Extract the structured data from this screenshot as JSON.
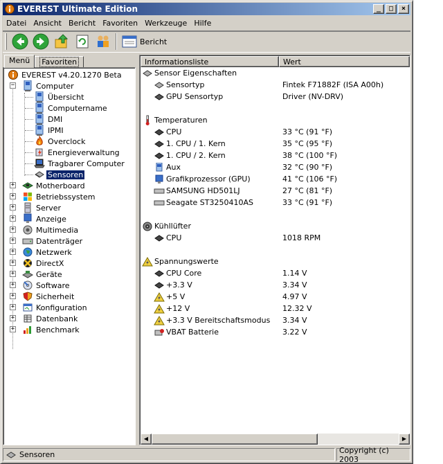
{
  "window": {
    "title": "EVEREST Ultimate Edition",
    "icon": "info-icon"
  },
  "title_buttons": {
    "minimize": "_",
    "maximize": "□",
    "close": "×"
  },
  "menu": [
    "Datei",
    "Ansicht",
    "Bericht",
    "Favoriten",
    "Werkzeuge",
    "Hilfe"
  ],
  "toolbar": {
    "report_label": "Bericht"
  },
  "tabs": {
    "menu": "Menü",
    "favorites": "Favoriten"
  },
  "tree": {
    "root": "EVEREST v4.20.1270 Beta",
    "computer": "Computer",
    "computer_children": [
      "Übersicht",
      "Computername",
      "DMI",
      "IPMI",
      "Overclock",
      "Energieverwaltung",
      "Tragbarer Computer",
      "Sensoren"
    ],
    "sections": [
      "Motherboard",
      "Betriebssystem",
      "Server",
      "Anzeige",
      "Multimedia",
      "Datenträger",
      "Netzwerk",
      "DirectX",
      "Geräte",
      "Software",
      "Sicherheit",
      "Konfiguration",
      "Datenbank",
      "Benchmark"
    ]
  },
  "columns": {
    "field": "Informationsliste",
    "value": "Wert"
  },
  "groups": {
    "sensor_props": "Sensor Eigenschaften",
    "temps": "Temperaturen",
    "fans": "Kühllüfter",
    "voltages": "Spannungswerte"
  },
  "sensor_props": [
    {
      "field": "Sensortyp",
      "value": "Fintek F71882F  (ISA A00h)"
    },
    {
      "field": "GPU Sensortyp",
      "value": "Driver  (NV-DRV)"
    }
  ],
  "temps": [
    {
      "field": "CPU",
      "value": "33 °C  (91 °F)"
    },
    {
      "field": "1. CPU / 1. Kern",
      "value": "35 °C  (95 °F)"
    },
    {
      "field": "1. CPU / 2. Kern",
      "value": "38 °C  (100 °F)"
    },
    {
      "field": "Aux",
      "value": "32 °C  (90 °F)"
    },
    {
      "field": "Grafikprozessor (GPU)",
      "value": "41 °C  (106 °F)"
    },
    {
      "field": "SAMSUNG HD501LJ",
      "value": "27 °C  (81 °F)"
    },
    {
      "field": "Seagate ST3250410AS",
      "value": "33 °C  (91 °F)"
    }
  ],
  "fans": [
    {
      "field": "CPU",
      "value": "1018 RPM"
    }
  ],
  "voltages": [
    {
      "field": "CPU Core",
      "value": "1.14 V"
    },
    {
      "field": "+3.3 V",
      "value": "3.34 V"
    },
    {
      "field": "+5 V",
      "value": "4.97 V"
    },
    {
      "field": "+12 V",
      "value": "12.32 V"
    },
    {
      "field": "+3.3 V Bereitschaftsmodus",
      "value": "3.34 V"
    },
    {
      "field": "VBAT Batterie",
      "value": "3.22 V"
    }
  ],
  "statusbar": {
    "left": "Sensoren",
    "right": "Copyright (c) 2003"
  }
}
